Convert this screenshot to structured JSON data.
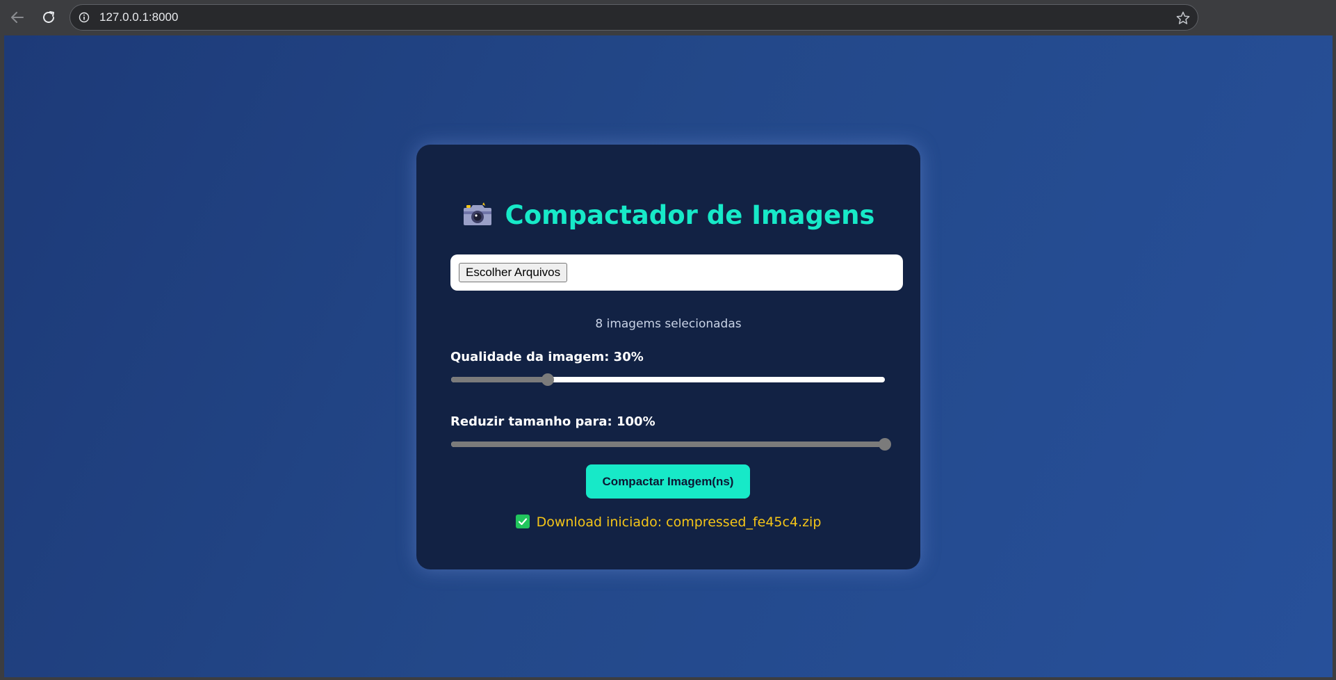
{
  "browser": {
    "url": "127.0.0.1:8000",
    "icons": [
      "back-arrow-icon",
      "reload-icon",
      "info-icon",
      "star-icon"
    ]
  },
  "app": {
    "title": "Compactador de Imagens",
    "title_icon": "camera-icon",
    "file_button_label": "Escolher Arquivos",
    "selected_count_text": "8 imagems selecionadas",
    "quality_label": "Qualidade da imagem: 30%",
    "quality_value_percent": 30,
    "size_label": "Reduzir tamanho para: 100%",
    "size_value_percent": 100,
    "compress_button_label": "Compactar Imagem(ns)",
    "status_text": "Download iniciado: compressed_fe45c4.zip",
    "status_icon": "check-icon"
  },
  "colors": {
    "accent": "#17e9c8",
    "card_background": "#122244",
    "page_background": "#234889",
    "status_text": "#f5c518",
    "check_green": "#21c55d"
  }
}
